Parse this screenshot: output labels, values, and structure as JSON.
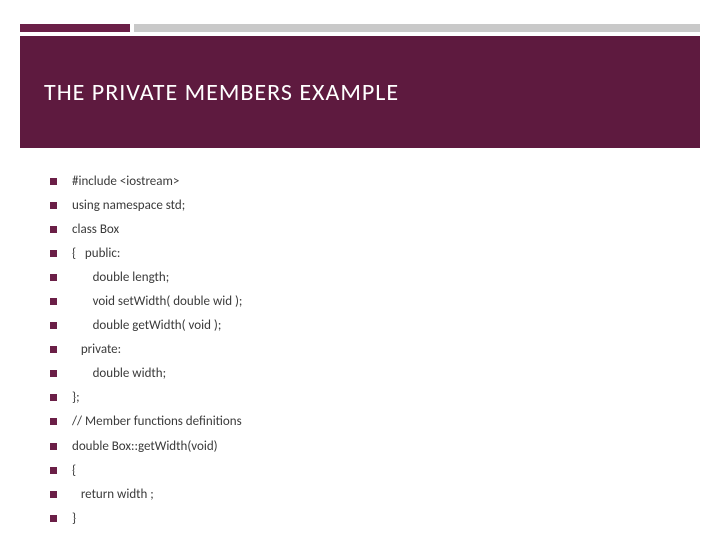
{
  "title": "THE PRIVATE MEMBERS EXAMPLE",
  "bullets": [
    "#include <iostream>",
    "using namespace std;",
    "class Box",
    "{   public:",
    "       double length;",
    "       void setWidth( double wid );",
    "       double getWidth( void );",
    "   private:",
    "       double width;",
    "};",
    "// Member functions definitions",
    "double Box::getWidth(void)",
    "{",
    "   return width ;",
    "}"
  ],
  "colors": {
    "accent": "#6b1f47",
    "titleBg": "#5e1a3f",
    "gray": "#c9c9c9"
  }
}
